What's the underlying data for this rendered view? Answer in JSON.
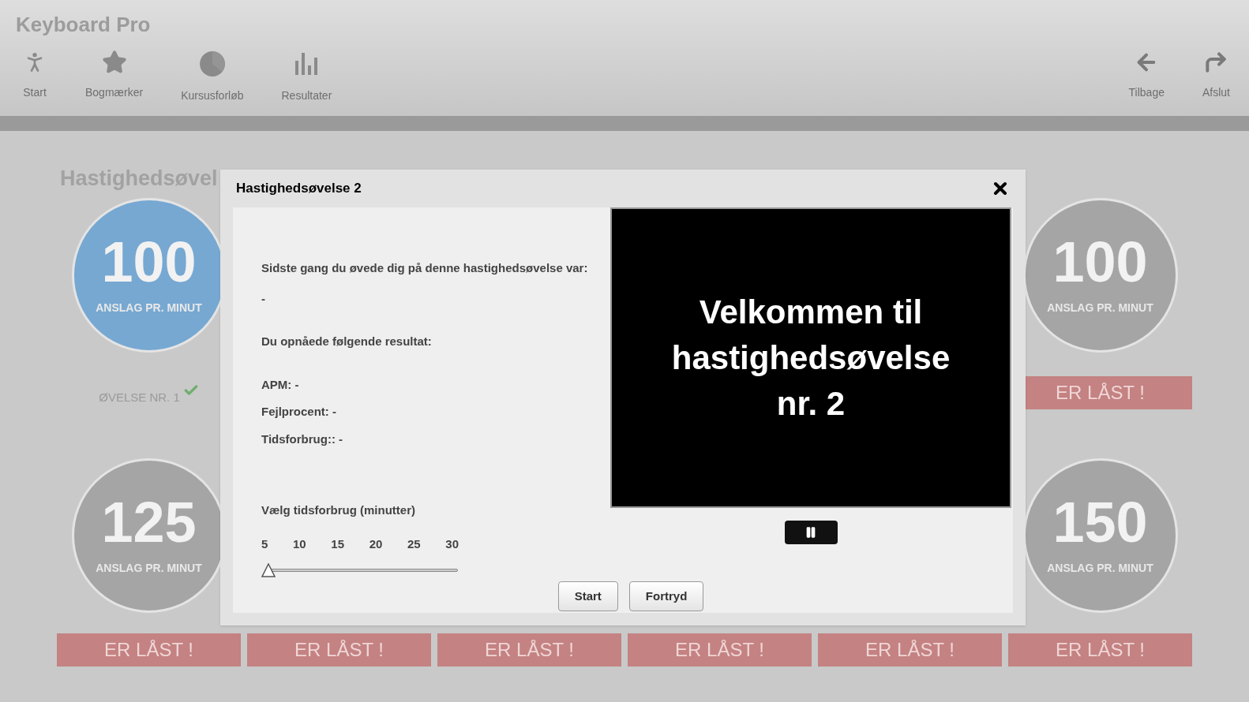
{
  "app": {
    "title": "Keyboard Pro"
  },
  "toolbar": {
    "left": [
      {
        "label": "Start"
      },
      {
        "label": "Bogmærker"
      },
      {
        "label": "Kursusforløb"
      },
      {
        "label": "Resultater"
      }
    ],
    "right": [
      {
        "label": "Tilbage"
      },
      {
        "label": "Afslut"
      }
    ]
  },
  "page": {
    "title": "Hastighedsøvel",
    "exercises": [
      {
        "number": "100",
        "unit": "ANSLAG PR. MINUT",
        "locked": false,
        "status": "ØVELSE NR. 1",
        "completed": true
      },
      {
        "number": "100",
        "unit": "ANSLAG PR. MINUT",
        "locked": true,
        "status": "ER LÅST !"
      },
      {
        "number": "125",
        "unit": "ANSLAG PR. MINUT",
        "locked": true
      },
      {
        "number": "150",
        "unit": "ANSLAG PR. MINUT",
        "locked": true
      }
    ],
    "locked_row": [
      "ER LÅST !",
      "ER LÅST !",
      "ER LÅST !",
      "ER LÅST !",
      "ER LÅST !",
      "ER LÅST !"
    ]
  },
  "dialog": {
    "title": "Hastighedsøvelse 2",
    "last_label": "Sidste gang du øvede dig på denne hastighedsøvelse var:",
    "last_value": "-",
    "result_label": "Du opnåede følgende resultat:",
    "results": [
      "APM: -",
      "Fejlprocent: -",
      "Tidsforbrug:: -"
    ],
    "slider": {
      "label": "Vælg tidsforbrug (minutter)",
      "ticks": [
        "5",
        "10",
        "15",
        "20",
        "25",
        "30"
      ],
      "level": 0
    },
    "video": {
      "lines": [
        "Velkommen til",
        "hastighedsøvelse",
        "nr. 2"
      ]
    },
    "buttons": [
      "Start",
      "Fortryd"
    ]
  }
}
